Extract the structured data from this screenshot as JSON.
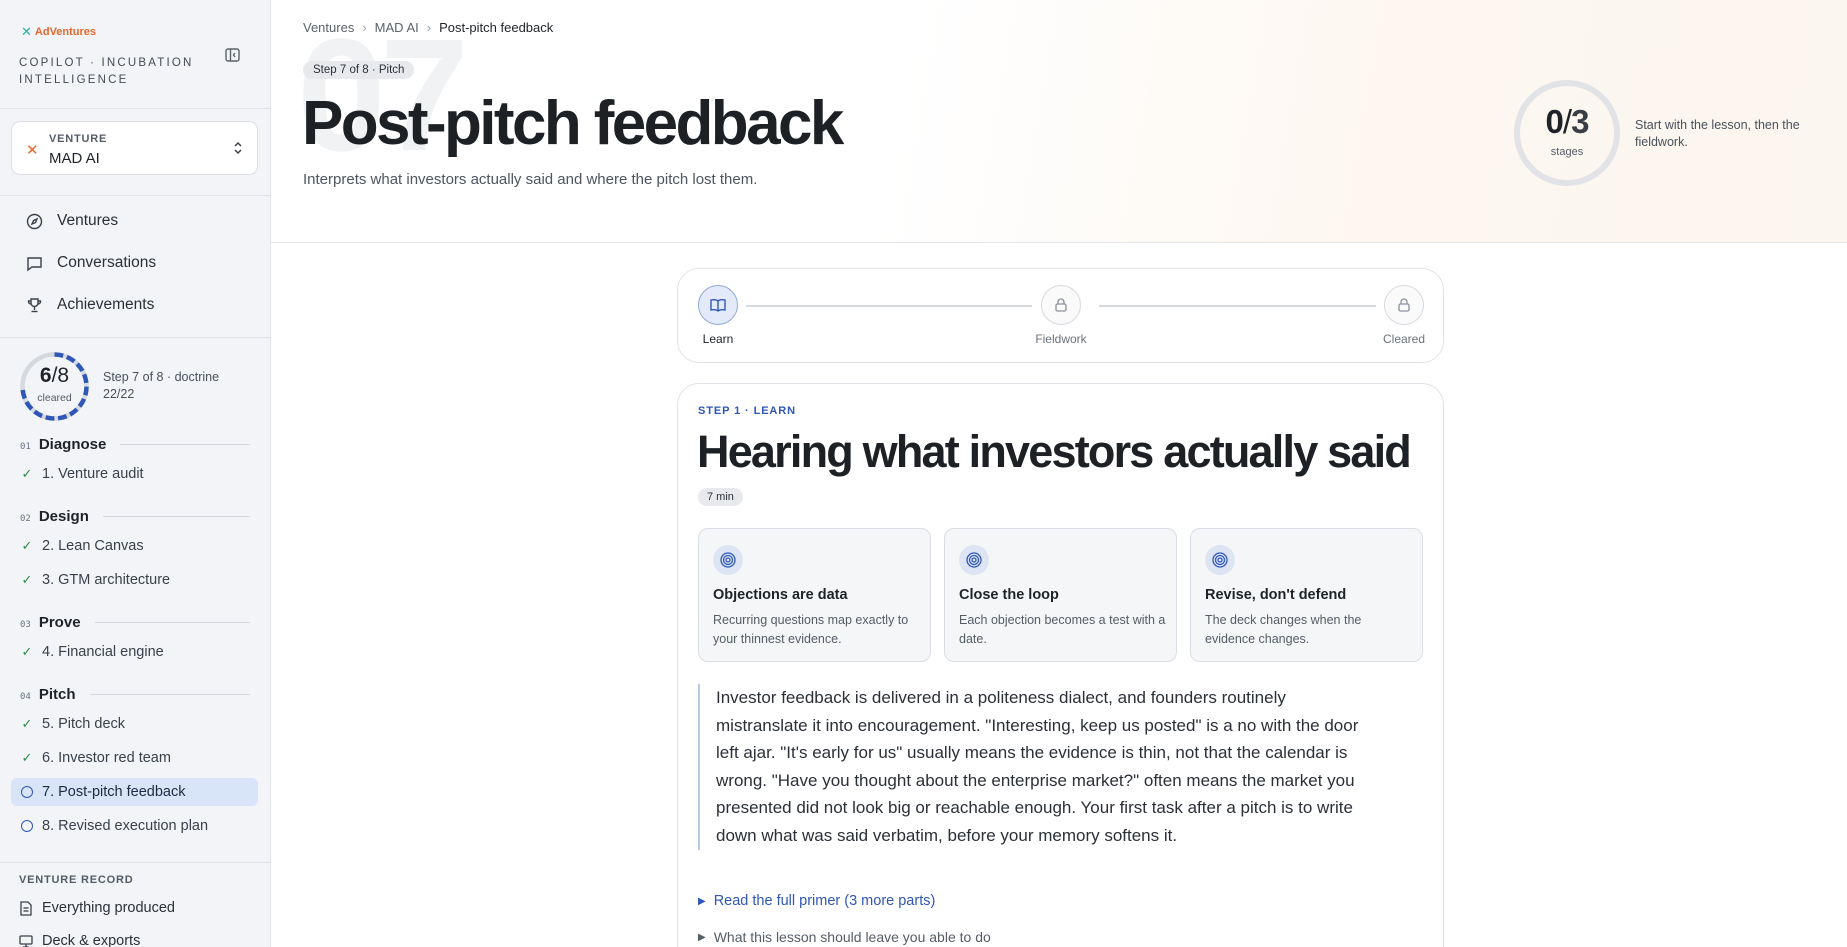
{
  "sidebar": {
    "brand": "AdVentures",
    "brand_subtitle": "COPILOT · INCUBATION INTELLIGENCE",
    "venture": {
      "label": "VENTURE",
      "name": "MAD AI"
    },
    "nav": [
      {
        "label": "Ventures",
        "icon": "compass-icon"
      },
      {
        "label": "Conversations",
        "icon": "chat-icon"
      },
      {
        "label": "Achievements",
        "icon": "trophy-icon"
      }
    ],
    "progress": {
      "done": "6",
      "total": "8",
      "sub": "cleared",
      "caption": "Step 7 of 8 · doctrine 22/22",
      "fraction": 0.75
    },
    "sections": [
      {
        "num": "01",
        "name": "Diagnose",
        "steps": [
          {
            "label": "1. Venture audit",
            "status": "done"
          }
        ]
      },
      {
        "num": "02",
        "name": "Design",
        "steps": [
          {
            "label": "2. Lean Canvas",
            "status": "done"
          },
          {
            "label": "3. GTM architecture",
            "status": "done"
          }
        ]
      },
      {
        "num": "03",
        "name": "Prove",
        "steps": [
          {
            "label": "4. Financial engine",
            "status": "done"
          }
        ]
      },
      {
        "num": "04",
        "name": "Pitch",
        "steps": [
          {
            "label": "5. Pitch deck",
            "status": "done"
          },
          {
            "label": "6. Investor red team",
            "status": "done"
          },
          {
            "label": "7. Post-pitch feedback",
            "status": "active"
          },
          {
            "label": "8. Revised execution plan",
            "status": "todo"
          }
        ]
      }
    ],
    "record": {
      "label": "VENTURE RECORD",
      "items": [
        {
          "label": "Everything produced",
          "icon": "document-icon"
        },
        {
          "label": "Deck & exports",
          "icon": "monitor-icon"
        }
      ]
    }
  },
  "header": {
    "breadcrumb": [
      "Ventures",
      "MAD AI",
      "Post-pitch feedback"
    ],
    "step_ghost": "07",
    "step_badge": "Step 7 of 8 · Pitch",
    "title": "Post-pitch feedback",
    "subtitle": "Interprets what investors actually said and where the pitch lost them.",
    "stages": {
      "done": "0",
      "total": "3",
      "sub": "stages",
      "caption": "Start with the lesson, then the fieldwork.",
      "fraction": 0
    }
  },
  "stepper": [
    {
      "label": "Learn",
      "state": "current",
      "icon": "book-icon"
    },
    {
      "label": "Fieldwork",
      "state": "locked",
      "icon": "lock-icon"
    },
    {
      "label": "Cleared",
      "state": "locked",
      "icon": "lock-icon"
    }
  ],
  "lesson": {
    "eyebrow": "STEP 1 · LEARN",
    "title": "Hearing what investors actually said",
    "time": "7 min",
    "pillars": [
      {
        "title": "Objections are data",
        "body": "Recurring questions map exactly to your thinnest evidence.",
        "icon": "target-icon"
      },
      {
        "title": "Close the loop",
        "body": "Each objection becomes a test with a date.",
        "icon": "target-icon"
      },
      {
        "title": "Revise, don't defend",
        "body": "The deck changes when the evidence changes.",
        "icon": "target-icon"
      }
    ],
    "quote": "Investor feedback is delivered in a politeness dialect, and founders routinely mistranslate it into encouragement. \"Interesting, keep us posted\" is a no with the door left ajar. \"It's early for us\" usually means the evidence is thin, not that the calendar is wrong. \"Have you thought about the enterprise market?\" often means the market you presented did not look big or reachable enough. Your first task after a pitch is to write down what was said verbatim, before your memory softens it.",
    "primer_link": "Read the full primer (3 more parts)",
    "outcomes_link": "What this lesson should leave you able to do"
  },
  "colors": {
    "accent": "#2f57b5",
    "brand_orange": "#e8672c",
    "brand_teal": "#20b3a6",
    "done_green": "#2a8a4a"
  }
}
